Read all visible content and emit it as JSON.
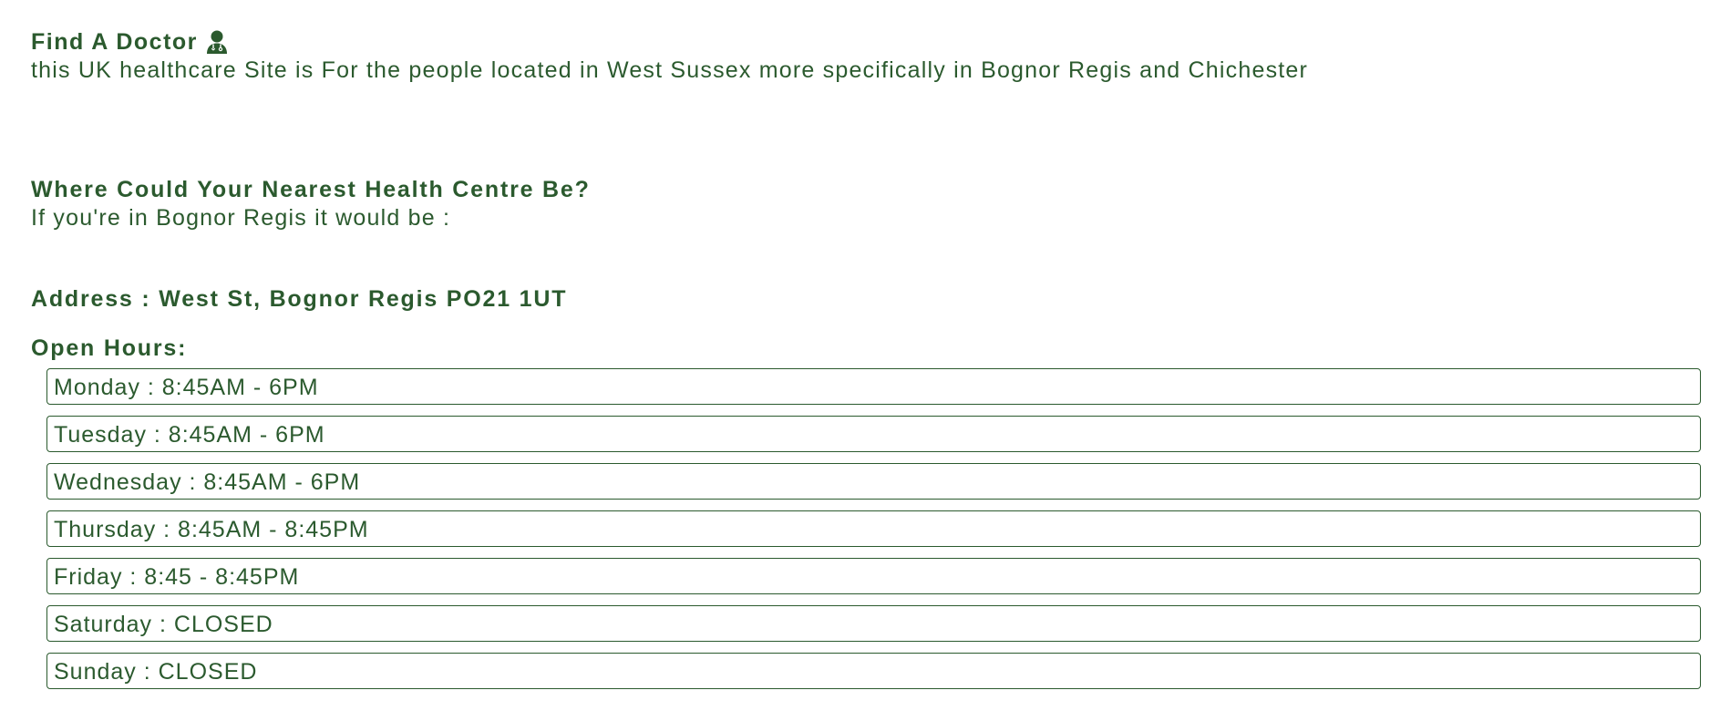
{
  "header": {
    "title": "Find A Doctor",
    "title_icon": "doctor-icon",
    "tagline": "this UK healthcare Site is For the people located in West Sussex more specifically in Bognor Regis and Chichester"
  },
  "nearest_centre": {
    "heading": "Where Could Your Nearest Health Centre Be?",
    "intro": "If you're in Bognor Regis it would be :",
    "address": "Address : West St, Bognor Regis PO21 1UT",
    "hours_heading": "Open Hours:",
    "hours": [
      "Monday : 8:45AM - 6PM",
      "Tuesday : 8:45AM - 6PM",
      "Wednesday : 8:45AM - 6PM",
      "Thursday : 8:45AM - 8:45PM",
      "Friday : 8:45 - 8:45PM",
      "Saturday : CLOSED",
      "Sunday : CLOSED"
    ]
  },
  "colors": {
    "text": "#2b5a2e",
    "background": "#ffffff",
    "border": "#2b5a2e"
  }
}
